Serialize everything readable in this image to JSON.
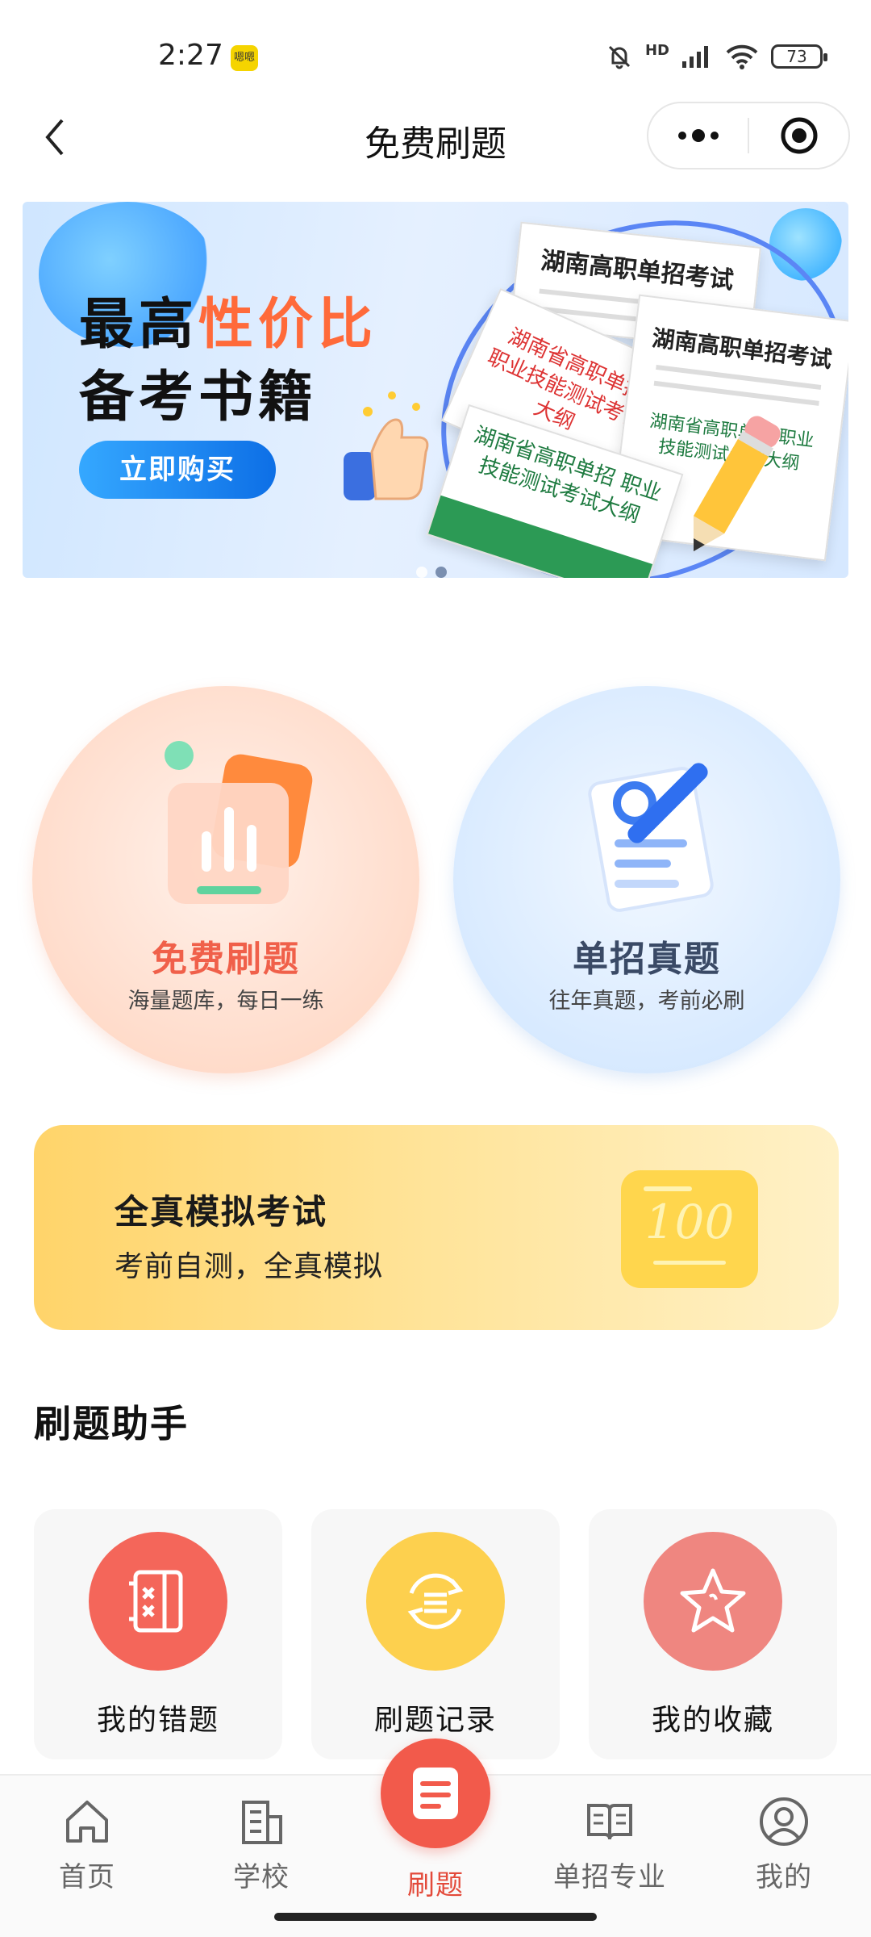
{
  "status_bar": {
    "time": "2:27",
    "app_badge": "嗯嗯",
    "network": "HD",
    "battery": "73"
  },
  "nav": {
    "title": "免费刷题"
  },
  "banner": {
    "headline_prefix": "最高",
    "headline_highlight": "性价比",
    "headline_line2": "备考书籍",
    "buy_button": "立即购买",
    "book1_title": "湖南高职单招考试",
    "book2_title": "湖南高职单招考试",
    "book3_title": "湖南省高职单招 职业技能测试考试大纲",
    "book4_title": "湖南省高职单招 职业技能测试考试大纲",
    "slide_count": 2,
    "active_slide": 2,
    "accent_color": "#ff6a3a"
  },
  "features": [
    {
      "title": "免费刷题",
      "subtitle": "海量题库，每日一练",
      "title_color": "#f0604a"
    },
    {
      "title": "单招真题",
      "subtitle": "往年真题，考前必刷",
      "title_color": "#3a4a66"
    }
  ],
  "mock_exam": {
    "title": "全真模拟考试",
    "subtitle": "考前自测，全真模拟",
    "icon_text": "100"
  },
  "helper": {
    "section_title": "刷题助手",
    "items": [
      {
        "label": "我的错题",
        "icon": "wrong-answers-icon",
        "color": "#f4665a"
      },
      {
        "label": "刷题记录",
        "icon": "practice-history-icon",
        "color": "#fdd04e"
      },
      {
        "label": "我的收藏",
        "icon": "favorites-star-icon",
        "color": "#ef8680"
      }
    ]
  },
  "tab_bar": {
    "items": [
      {
        "label": "首页",
        "icon": "home-icon"
      },
      {
        "label": "学校",
        "icon": "school-icon"
      },
      {
        "label": "刷题",
        "icon": "practice-icon",
        "active": true
      },
      {
        "label": "单招专业",
        "icon": "majors-book-icon"
      },
      {
        "label": "我的",
        "icon": "profile-icon"
      }
    ],
    "active_color": "#e34a3a"
  }
}
